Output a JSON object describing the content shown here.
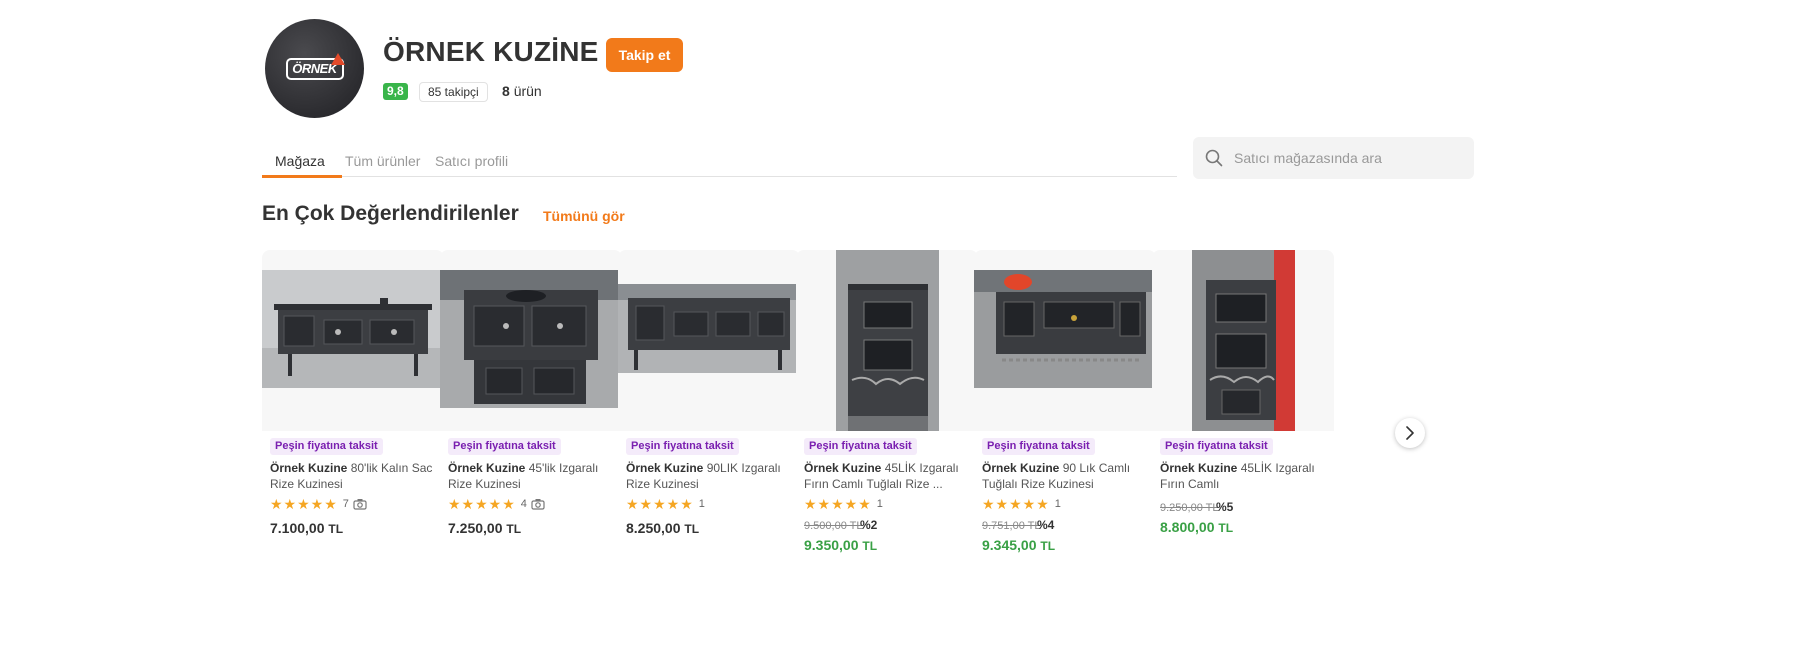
{
  "store": {
    "logo_text": "ÖRNEK",
    "name": "ÖRNEK KUZİNE",
    "follow_label": "Takip et",
    "score": "9,8",
    "followers": "85 takipçi",
    "product_count_num": "8",
    "product_count_label": "ürün"
  },
  "tabs": [
    {
      "label": "Mağaza",
      "active": true
    },
    {
      "label": "Tüm ürünler",
      "active": false
    },
    {
      "label": "Satıcı profili",
      "active": false
    }
  ],
  "search": {
    "placeholder": "Satıcı mağazasında ara",
    "icon": "search-icon"
  },
  "section": {
    "title": "En Çok Değerlendirilenler",
    "see_all": "Tümünü gör"
  },
  "products": [
    {
      "badge": "Peşin fiyatına taksit",
      "brand": "Örnek Kuzine",
      "name": "80'lik Kalın Sac Rize Kuzinesi",
      "stars": "★★★★★",
      "rating_count": "7",
      "has_photo": true,
      "price": "7.100,00",
      "currency": "TL"
    },
    {
      "badge": "Peşin fiyatına taksit",
      "brand": "Örnek Kuzine",
      "name": "45'lik Izgaralı Rize Kuzinesi",
      "stars": "★★★★★",
      "rating_count": "4",
      "has_photo": true,
      "price": "7.250,00",
      "currency": "TL"
    },
    {
      "badge": "Peşin fiyatına taksit",
      "brand": "Örnek Kuzine",
      "name": "90LIK Izgaralı Rize Kuzinesi",
      "stars": "★★★★★",
      "rating_count": "1",
      "has_photo": false,
      "price": "8.250,00",
      "currency": "TL"
    },
    {
      "badge": "Peşin fiyatına taksit",
      "brand": "Örnek Kuzine",
      "name": "45LİK Izgaralı Fırın Camlı Tuğlalı Rize ...",
      "stars": "★★★★★",
      "rating_count": "1",
      "has_photo": false,
      "old_price": "9.500,00 TL",
      "discount": "%2",
      "price": "9.350,00",
      "currency": "TL"
    },
    {
      "badge": "Peşin fiyatına taksit",
      "brand": "Örnek Kuzine",
      "name": "90 Lık Camlı Tuğlalı Rize Kuzinesi",
      "stars": "★★★★★",
      "rating_count": "1",
      "has_photo": false,
      "old_price": "9.751,00 TL",
      "discount": "%4",
      "price": "9.345,00",
      "currency": "TL"
    },
    {
      "badge": "Peşin fiyatına taksit",
      "brand": "Örnek Kuzine",
      "name": "45LİK Izgaralı Fırın Camlı",
      "stars": "",
      "rating_count": "",
      "has_photo": false,
      "old_price": "9.250,00 TL",
      "discount": "%5",
      "price": "8.800,00",
      "currency": "TL"
    }
  ],
  "colors": {
    "accent": "#f27a1a",
    "score_green": "#39b54a",
    "sale_green": "#39a045",
    "badge_purple": "#7a1fb0",
    "star": "#f5a623"
  },
  "carousel": {
    "next_icon": "chevron-right-icon"
  }
}
